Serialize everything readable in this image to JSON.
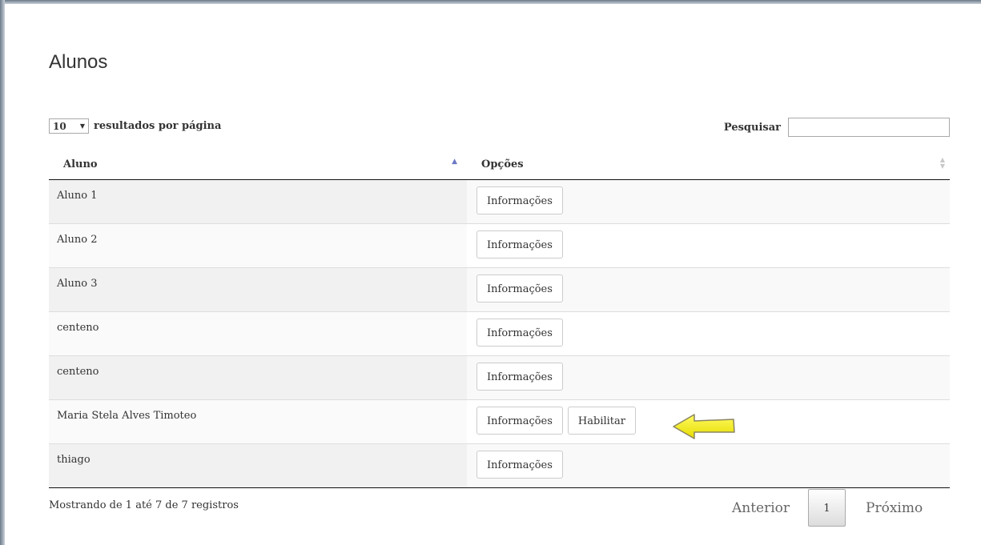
{
  "page": {
    "title": "Alunos"
  },
  "controls": {
    "length_value": "10",
    "length_suffix": "resultados por página",
    "search_label": "Pesquisar",
    "search_value": ""
  },
  "table": {
    "columns": [
      "Aluno",
      "Opções"
    ],
    "rows": [
      {
        "name": "Aluno 1",
        "actions": [
          "Informações"
        ]
      },
      {
        "name": "Aluno 2",
        "actions": [
          "Informações"
        ]
      },
      {
        "name": "Aluno 3",
        "actions": [
          "Informações"
        ]
      },
      {
        "name": "centeno",
        "actions": [
          "Informações"
        ]
      },
      {
        "name": "centeno",
        "actions": [
          "Informações"
        ]
      },
      {
        "name": "Maria Stela Alves Timoteo",
        "actions": [
          "Informações",
          "Habilitar"
        ]
      },
      {
        "name": "thiago",
        "actions": [
          "Informações"
        ]
      }
    ]
  },
  "footer": {
    "info": "Mostrando de 1 até 7 de 7 registros",
    "prev_label": "Anterior",
    "current_page": "1",
    "next_label": "Próximo"
  },
  "annotation": {
    "arrow_color": "#f5f000",
    "icon": "arrow-left-icon"
  }
}
